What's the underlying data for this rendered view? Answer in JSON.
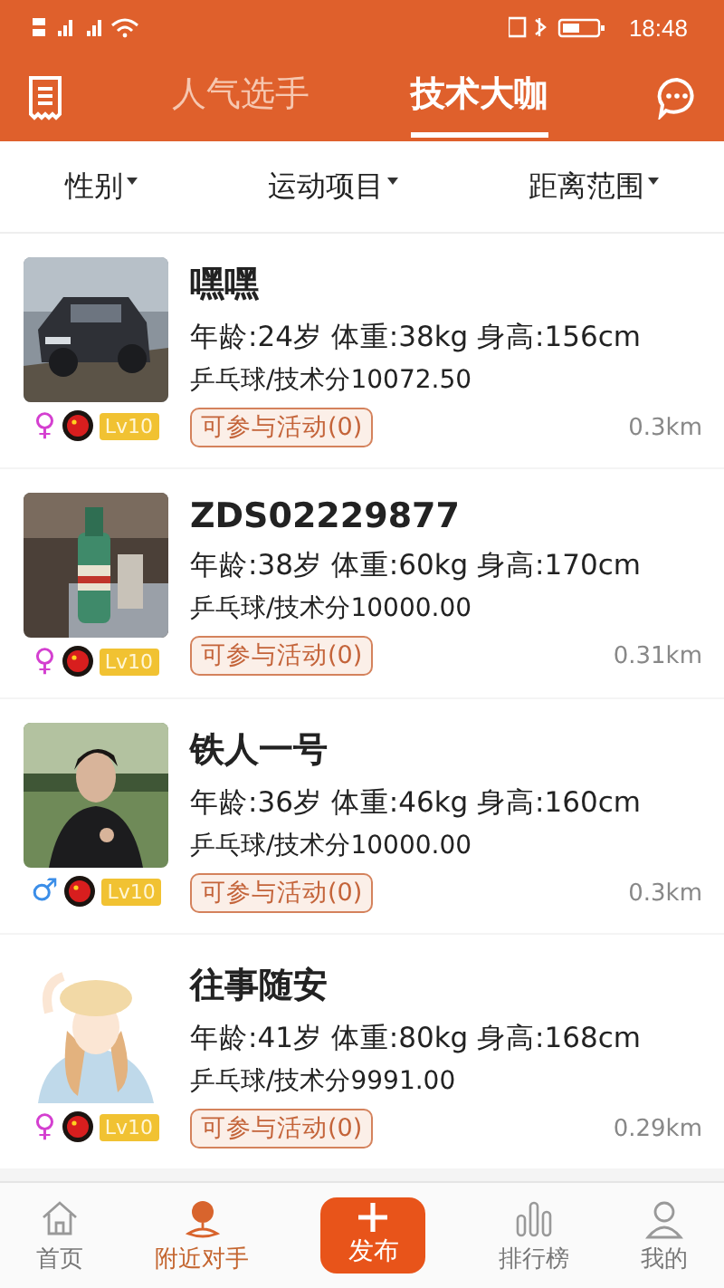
{
  "status_bar": {
    "time": "18:48"
  },
  "header": {
    "tabs": [
      {
        "label": "人气选手",
        "selected": false
      },
      {
        "label": "技术大咖",
        "selected": true
      }
    ]
  },
  "filters": [
    {
      "label": "性别"
    },
    {
      "label": "运动项目"
    },
    {
      "label": "距离范围"
    }
  ],
  "players": [
    {
      "name": "嘿嘿",
      "stats": "年龄:24岁 体重:38kg 身高:156cm",
      "score": "乒乓球/技术分10072.50",
      "kind": "female",
      "gender_symbol": "♀",
      "level": "Lv10",
      "activity": "可参与活动(0)",
      "distance": "0.3km"
    },
    {
      "name": "ZDS02229877",
      "stats": "年龄:38岁 体重:60kg 身高:170cm",
      "score": "乒乓球/技术分10000.00",
      "kind": "female",
      "gender_symbol": "♀",
      "level": "Lv10",
      "activity": "可参与活动(0)",
      "distance": "0.31km"
    },
    {
      "name": "铁人一号",
      "stats": "年龄:36岁 体重:46kg 身高:160cm",
      "score": "乒乓球/技术分10000.00",
      "kind": "male",
      "gender_symbol": "♂",
      "level": "Lv10",
      "activity": "可参与活动(0)",
      "distance": "0.3km"
    },
    {
      "name": "往事随安",
      "stats": "年龄:41岁 体重:80kg 身高:168cm",
      "score": "乒乓球/技术分9991.00",
      "kind": "female",
      "gender_symbol": "♀",
      "level": "Lv10",
      "activity": "可参与活动(0)",
      "distance": "0.29km"
    }
  ],
  "tab_bar": [
    {
      "label": "首页",
      "kind": "home",
      "selected": false
    },
    {
      "label": "附近对手",
      "kind": "nearby",
      "selected": true
    },
    {
      "label": "发布",
      "kind": "publish"
    },
    {
      "label": "排行榜",
      "kind": "rank",
      "selected": false
    },
    {
      "label": "我的",
      "kind": "me",
      "selected": false
    }
  ]
}
